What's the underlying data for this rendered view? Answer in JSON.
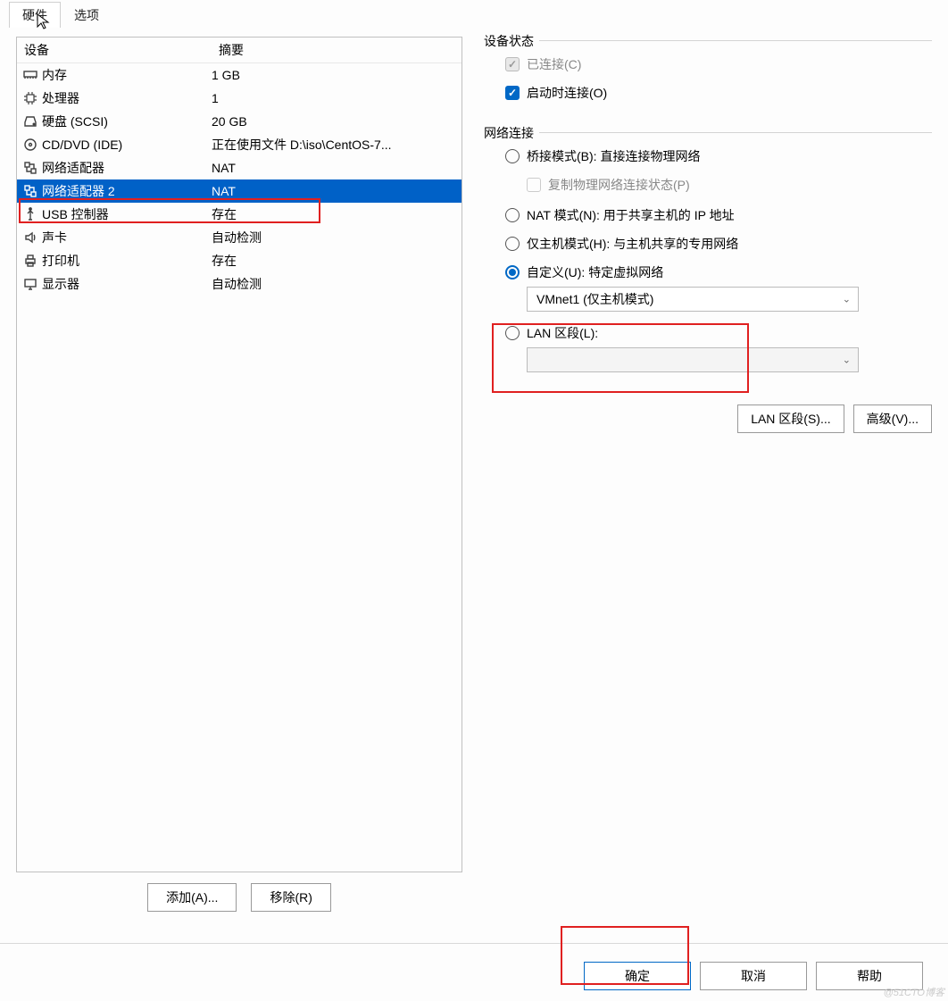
{
  "tabs": {
    "hardware": "硬件",
    "options": "选项"
  },
  "list": {
    "header_device": "设备",
    "header_summary": "摘要",
    "rows": [
      {
        "device": "内存",
        "summary": "1 GB"
      },
      {
        "device": "处理器",
        "summary": "1"
      },
      {
        "device": "硬盘 (SCSI)",
        "summary": "20 GB"
      },
      {
        "device": "CD/DVD (IDE)",
        "summary": "正在使用文件 D:\\iso\\CentOS-7..."
      },
      {
        "device": "网络适配器",
        "summary": "NAT"
      },
      {
        "device": "网络适配器 2",
        "summary": "NAT"
      },
      {
        "device": "USB 控制器",
        "summary": "存在"
      },
      {
        "device": "声卡",
        "summary": "自动检测"
      },
      {
        "device": "打印机",
        "summary": "存在"
      },
      {
        "device": "显示器",
        "summary": "自动检测"
      }
    ]
  },
  "left_buttons": {
    "add": "添加(A)...",
    "remove": "移除(R)"
  },
  "status": {
    "legend": "设备状态",
    "connected": "已连接(C)",
    "connect_on_start": "启动时连接(O)"
  },
  "network": {
    "legend": "网络连接",
    "bridge": "桥接模式(B): 直接连接物理网络",
    "replicate": "复制物理网络连接状态(P)",
    "nat": "NAT 模式(N): 用于共享主机的 IP 地址",
    "host_only": "仅主机模式(H): 与主机共享的专用网络",
    "custom": "自定义(U): 特定虚拟网络",
    "custom_select": "VMnet1 (仅主机模式)",
    "lan": "LAN 区段(L):",
    "lan_button": "LAN 区段(S)...",
    "advanced_button": "高级(V)..."
  },
  "bottom": {
    "ok": "确定",
    "cancel": "取消",
    "help": "帮助"
  },
  "watermark": "@51CTO博客"
}
